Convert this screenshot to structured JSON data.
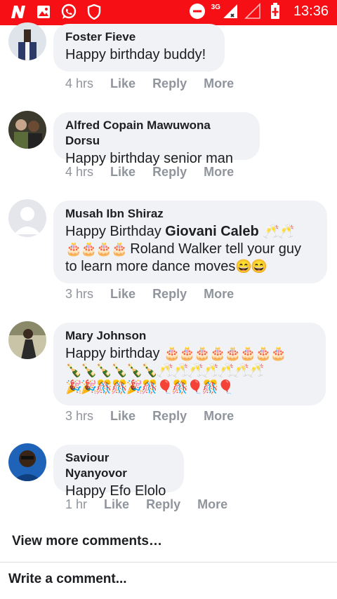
{
  "status_bar": {
    "network": "3G",
    "time": "13:36",
    "icons": [
      "n-logo-icon",
      "gallery-icon",
      "whatsapp-icon",
      "shield-icon",
      "do-not-disturb-icon",
      "signal-icon",
      "no-signal-icon",
      "battery-charging-icon"
    ],
    "bg_color": "#f70f16"
  },
  "comments": [
    {
      "name": "Foster Fieve",
      "text": "Happy birthday buddy!",
      "time": "4 hrs",
      "actions": [
        "Like",
        "Reply",
        "More"
      ]
    },
    {
      "name": "Alfred Copain Mawuwona Dorsu",
      "text": "Happy birthday senior man",
      "time": "4 hrs",
      "actions": [
        "Like",
        "Reply",
        "More"
      ]
    },
    {
      "name": "Musah Ibn Shiraz",
      "text_prefix": "Happy Birthday ",
      "mention": "Giovani Caleb",
      "emoji_glasses": "🥂🥂",
      "emoji_cakes": "🎂🎂🎂🎂",
      "text_suffix": " Roland Walker tell your guy to learn more dance moves",
      "emoji_end": "😄😄",
      "time": "3 hrs",
      "actions": [
        "Like",
        "Reply",
        "More"
      ]
    },
    {
      "name": "Mary Johnson",
      "text": "Happy birthday ",
      "emoji_line1": "🎂🎂🎂🎂🎂🎂🎂🎂",
      "emoji_line2": "🍾🍾🍾🍾🍾🍾🥂🥂🥂🥂🥂🥂🥂",
      "emoji_line3": "🎉🎉🎊🎊🎉🎊🎈🎊🎈🎊🎈",
      "time": "3 hrs",
      "actions": [
        "Like",
        "Reply",
        "More"
      ]
    },
    {
      "name": "Saviour Nyanyovor",
      "text": "Happy Efo Elolo",
      "time": "1 hr",
      "actions": [
        "Like",
        "Reply",
        "More"
      ]
    }
  ],
  "footer": {
    "view_more": "View more comments…",
    "write_placeholder": "Write a comment..."
  }
}
